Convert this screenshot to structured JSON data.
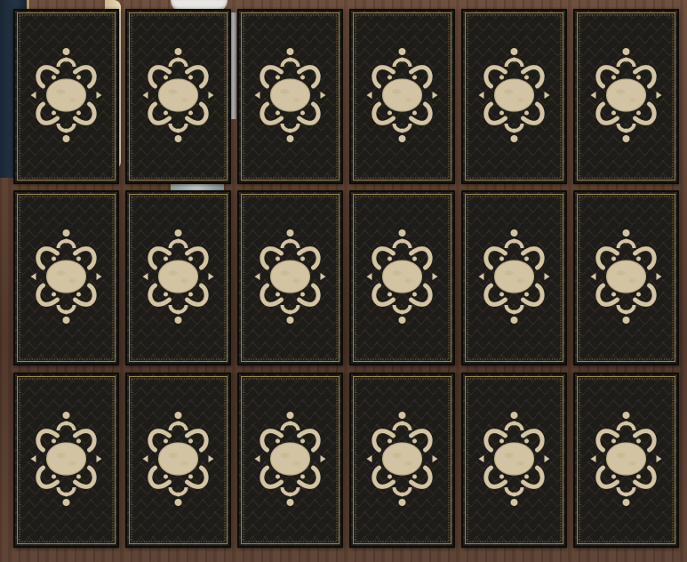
{
  "game": {
    "board": {
      "rows": 3,
      "columns": 6,
      "cards": [
        {
          "id": 1,
          "row": 1,
          "col": 1,
          "state": "face-down"
        },
        {
          "id": 2,
          "row": 1,
          "col": 2,
          "state": "face-down"
        },
        {
          "id": 3,
          "row": 1,
          "col": 3,
          "state": "face-down"
        },
        {
          "id": 4,
          "row": 1,
          "col": 4,
          "state": "face-down"
        },
        {
          "id": 5,
          "row": 1,
          "col": 5,
          "state": "face-down"
        },
        {
          "id": 6,
          "row": 1,
          "col": 6,
          "state": "face-down"
        },
        {
          "id": 7,
          "row": 2,
          "col": 1,
          "state": "face-down"
        },
        {
          "id": 8,
          "row": 2,
          "col": 2,
          "state": "face-down"
        },
        {
          "id": 9,
          "row": 2,
          "col": 3,
          "state": "face-down"
        },
        {
          "id": 10,
          "row": 2,
          "col": 4,
          "state": "face-down"
        },
        {
          "id": 11,
          "row": 2,
          "col": 5,
          "state": "face-down"
        },
        {
          "id": 12,
          "row": 2,
          "col": 6,
          "state": "face-down"
        },
        {
          "id": 13,
          "row": 3,
          "col": 1,
          "state": "face-down"
        },
        {
          "id": 14,
          "row": 3,
          "col": 2,
          "state": "face-down"
        },
        {
          "id": 15,
          "row": 3,
          "col": 3,
          "state": "face-down"
        },
        {
          "id": 16,
          "row": 3,
          "col": 4,
          "state": "face-down"
        },
        {
          "id": 17,
          "row": 3,
          "col": 5,
          "state": "face-down"
        },
        {
          "id": 18,
          "row": 3,
          "col": 6,
          "state": "face-down"
        }
      ]
    },
    "card_back": {
      "design": "ornate-moon-medallion",
      "corner_symbol": "crescent-moon-icon",
      "center_symbol": "full-moon-icon"
    },
    "colors": {
      "card_base": "#1e1c18",
      "card_border": "#0d0c0a",
      "gold_frame": "#9c8654",
      "ornament": "#d2c4a2",
      "table_wood": "#5a3e2f"
    }
  }
}
